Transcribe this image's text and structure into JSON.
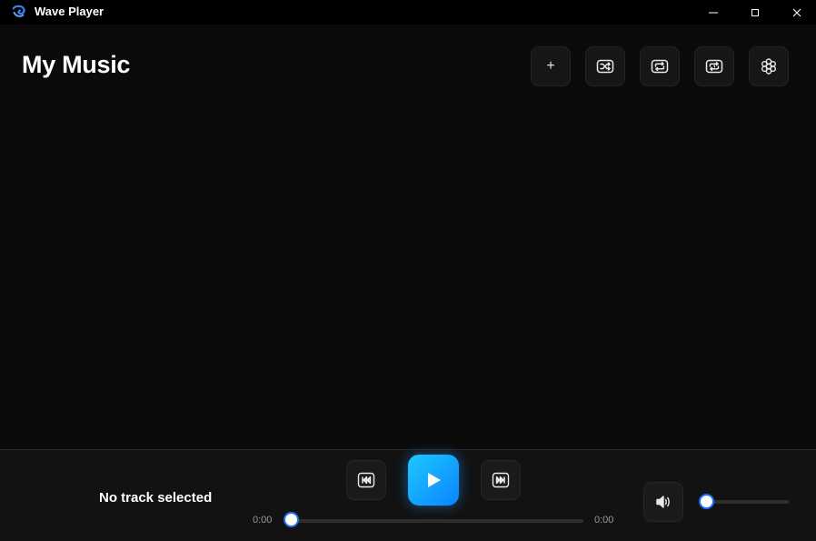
{
  "window": {
    "title": "Wave Player",
    "controls": {
      "minimize": "minimize-icon",
      "maximize": "maximize-icon",
      "close": "close-icon"
    }
  },
  "header": {
    "title": "My Music",
    "add_label": "+",
    "toolbar_icons": [
      "plus-icon",
      "shuffle-icon",
      "repeat-icon",
      "repeat-one-icon",
      "settings-icon"
    ]
  },
  "player": {
    "track_title": "No track selected",
    "current_time": "0:00",
    "total_time": "0:00",
    "progress": 0,
    "volume": 0,
    "icons": [
      "previous-icon",
      "play-icon",
      "next-icon",
      "volume-icon"
    ]
  },
  "colors": {
    "accent": "#0a84ff",
    "accent_light": "#1ec8ff",
    "background": "#0b0b0b",
    "player_bar": "#121212",
    "title_bar": "#000000"
  }
}
